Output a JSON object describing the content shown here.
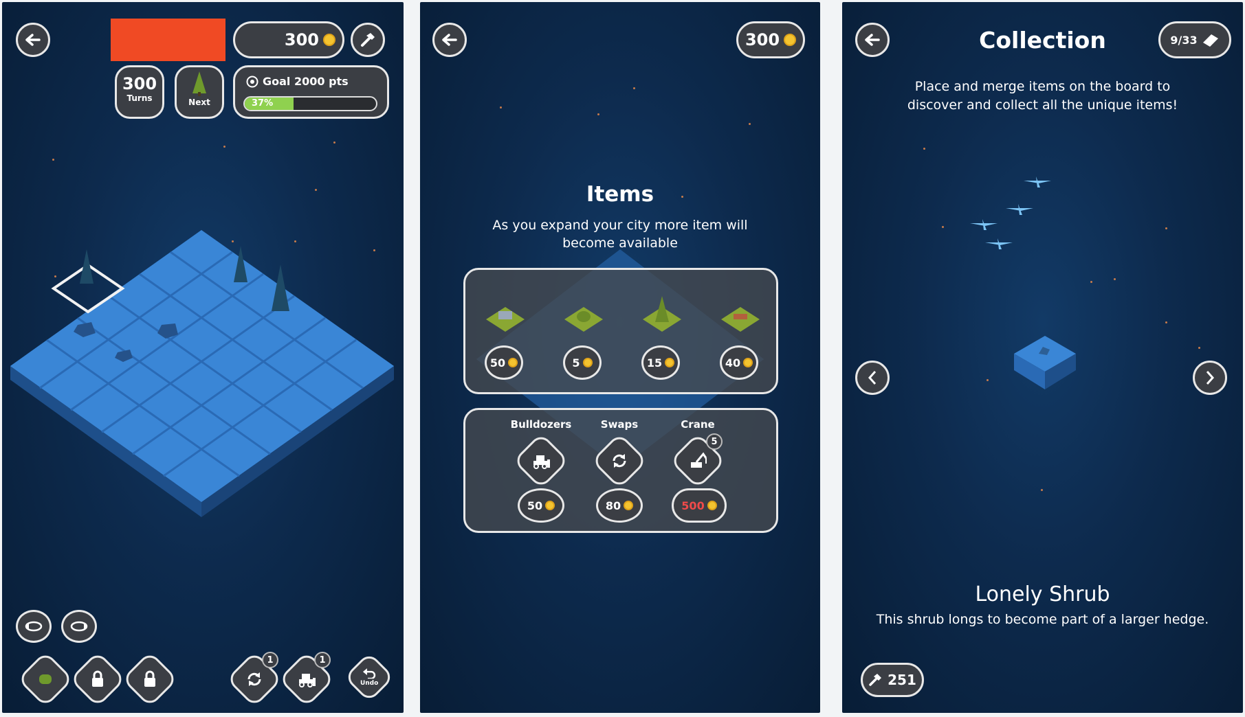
{
  "colors": {
    "accent_red": "#f04a24",
    "coin": "#f4c430",
    "progress": "#8fd14f",
    "board": "#3a86d6"
  },
  "screen1": {
    "coins": "300",
    "turns_value": "300",
    "turns_label": "Turns",
    "next_label": "Next",
    "goal_text": "Goal 2000 pts",
    "progress_percent": 37,
    "progress_label": "37%"
  },
  "screen2": {
    "coins": "300",
    "items_title": "Items",
    "items_subtitle": "As you expand your city more item will become available",
    "item_prices": [
      "50",
      "5",
      "15",
      "40"
    ],
    "tools": [
      {
        "label": "Bulldozers",
        "price": "50"
      },
      {
        "label": "Swaps",
        "price": "80"
      },
      {
        "label": "Crane",
        "price": "500",
        "badge": "5"
      }
    ]
  },
  "screen3": {
    "title": "Collection",
    "count": "9/33",
    "description": "Place and merge items on the board to discover and collect all the unique items!",
    "item_name": "Lonely Shrub",
    "item_desc": "This shrub longs to become part of a larger hedge.",
    "hammer_count": "251"
  },
  "toolbar_badges": {
    "swap": "1",
    "bulldozer": "1"
  },
  "undo_label": "Undo"
}
